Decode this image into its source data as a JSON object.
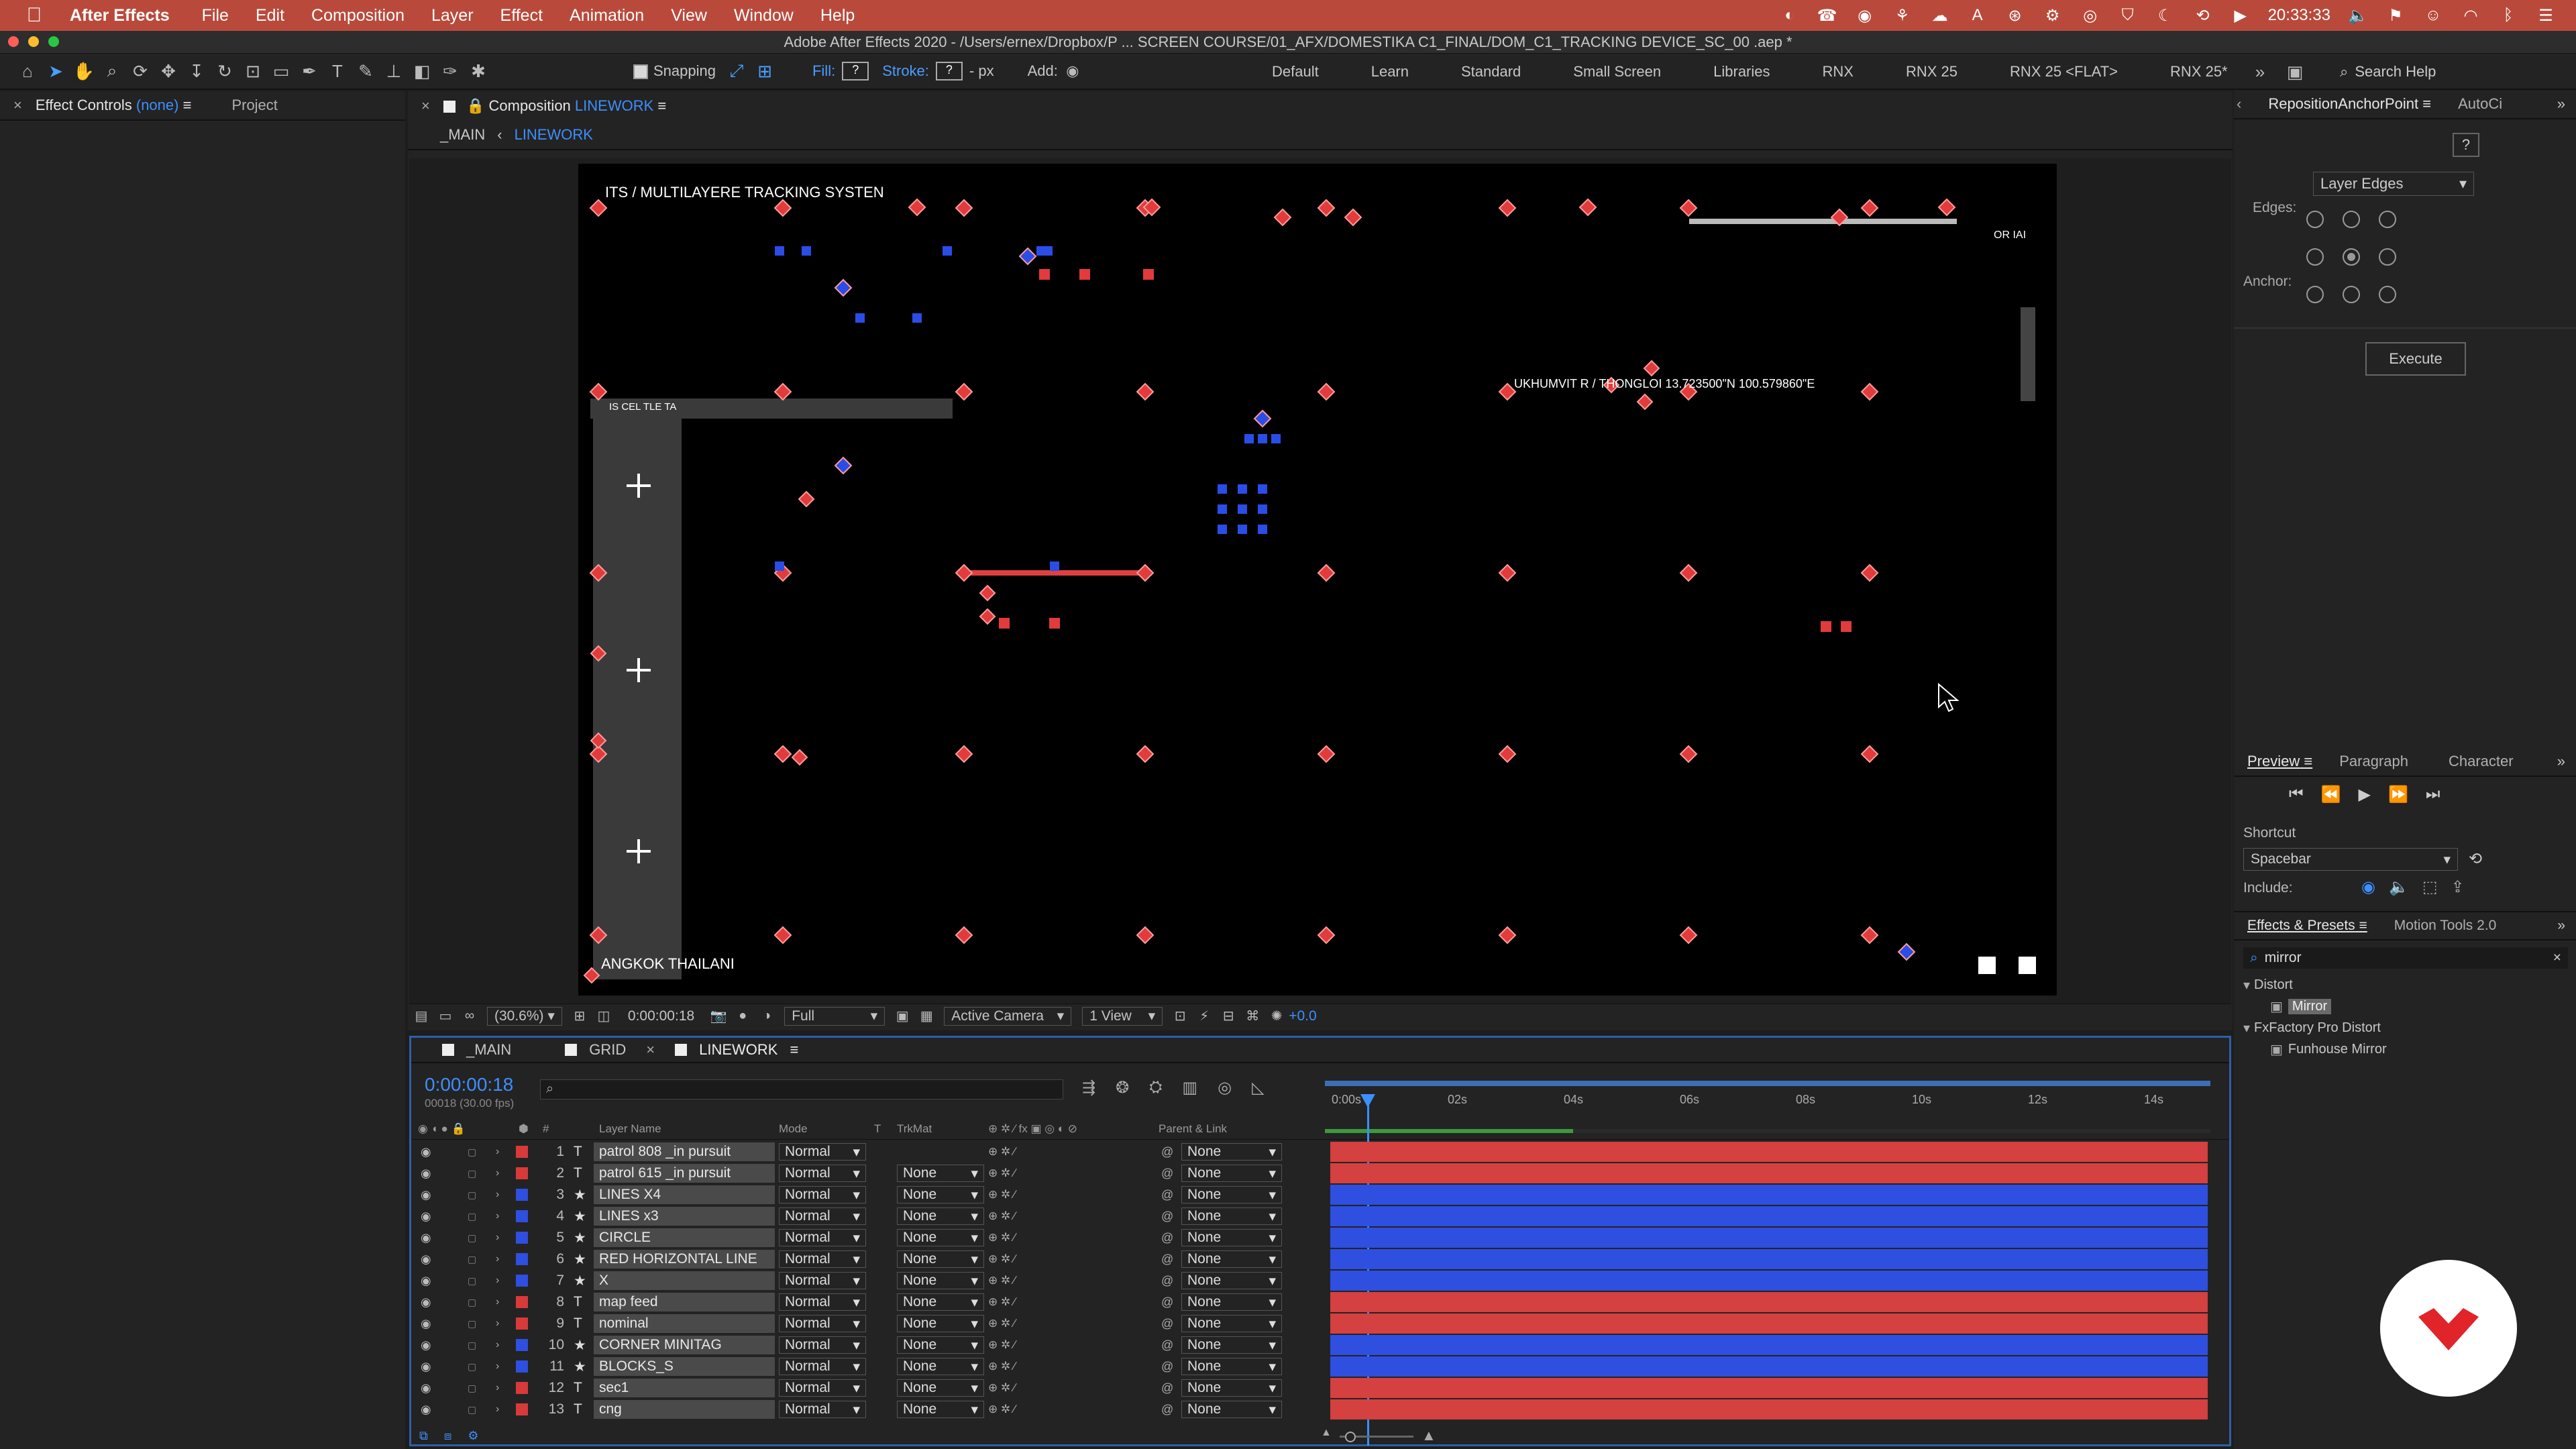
{
  "menubar": {
    "app": "After Effects",
    "items": [
      "File",
      "Edit",
      "Composition",
      "Layer",
      "Effect",
      "Animation",
      "View",
      "Window",
      "Help"
    ],
    "clock": "20:33:33"
  },
  "window": {
    "title": "Adobe After Effects 2020 - /Users/ernex/Dropbox/P ... SCREEN COURSE/01_AFX/DOMESTIKA C1_FINAL/DOM_C1_TRACKING DEVICE_SC_00 .aep *"
  },
  "toolbar": {
    "snapping_label": "Snapping",
    "fill_label": "Fill:",
    "fill_value": "?",
    "stroke_label": "Stroke:",
    "stroke_value": "?",
    "px_label": "- px",
    "add_label": "Add:",
    "workspaces": [
      "Default",
      "Learn",
      "Standard",
      "Small Screen",
      "Libraries",
      "RNX",
      "RNX 25",
      "RNX 25 <FLAT>",
      "RNX 25*"
    ],
    "search_placeholder": "Search Help"
  },
  "left_panel": {
    "tab_effect_controls": "Effect Controls",
    "effect_controls_value": "(none)",
    "tab_project": "Project"
  },
  "comp_panel": {
    "tab_label": "Composition",
    "tab_comp": "LINEWORK",
    "breadcrumb_main": "_MAIN",
    "breadcrumb_current": "LINEWORK",
    "texts": {
      "top_left": "ITS / MULTILAYERE  TRACKING SYSTEN",
      "top_right": "OR  IAI",
      "left_bar": "IS CEL   TLE TA",
      "coords": "UKHUMVIT R  / THONGLOI   13.723500\"N  100.579860\"E",
      "bottom_left": "ANGKOK  THAILANI"
    }
  },
  "viewer_footer": {
    "zoom": "(30.6%)",
    "timecode": "0:00:00:18",
    "resolution": "Full",
    "camera": "Active Camera",
    "views": "1 View",
    "exposure": "+0.0"
  },
  "timeline": {
    "tabs": [
      "_MAIN",
      "GRID",
      "LINEWORK"
    ],
    "current_time": "0:00:00:18",
    "frame_info": "00018 (30.00 fps)",
    "ruler": [
      "0:00s",
      "02s",
      "04s",
      "06s",
      "08s",
      "10s",
      "12s",
      "14s"
    ],
    "playhead_progress": 0.04,
    "headers": {
      "num": "#",
      "layer_name": "Layer Name",
      "mode": "Mode",
      "t": "T",
      "trkmat": "TrkMat",
      "parent": "Parent & Link"
    },
    "layers": [
      {
        "num": "1",
        "type": "T",
        "name": "patrol 808 _in pursuit",
        "mode": "Normal",
        "trkmat": "",
        "parent": "None",
        "label": "#d83a3a"
      },
      {
        "num": "2",
        "type": "T",
        "name": "patrol 615 _in pursuit",
        "mode": "Normal",
        "trkmat": "None",
        "parent": "None",
        "label": "#d83a3a"
      },
      {
        "num": "3",
        "type": "★",
        "name": "LINES X4",
        "mode": "Normal",
        "trkmat": "None",
        "parent": "None",
        "label": "#2e4fe0"
      },
      {
        "num": "4",
        "type": "★",
        "name": "LINES x3",
        "mode": "Normal",
        "trkmat": "None",
        "parent": "None",
        "label": "#2e4fe0"
      },
      {
        "num": "5",
        "type": "★",
        "name": "CIRCLE",
        "mode": "Normal",
        "trkmat": "None",
        "parent": "None",
        "label": "#2e4fe0"
      },
      {
        "num": "6",
        "type": "★",
        "name": "RED HORIZONTAL LINE",
        "mode": "Normal",
        "trkmat": "None",
        "parent": "None",
        "label": "#2e4fe0"
      },
      {
        "num": "7",
        "type": "★",
        "name": "X",
        "mode": "Normal",
        "trkmat": "None",
        "parent": "None",
        "label": "#2e4fe0"
      },
      {
        "num": "8",
        "type": "T",
        "name": "map feed",
        "mode": "Normal",
        "trkmat": "None",
        "parent": "None",
        "label": "#d83a3a"
      },
      {
        "num": "9",
        "type": "T",
        "name": "nominal",
        "mode": "Normal",
        "trkmat": "None",
        "parent": "None",
        "label": "#d83a3a"
      },
      {
        "num": "10",
        "type": "★",
        "name": "CORNER MINITAG",
        "mode": "Normal",
        "trkmat": "None",
        "parent": "None",
        "label": "#2e4fe0"
      },
      {
        "num": "11",
        "type": "★",
        "name": "BLOCKS_S",
        "mode": "Normal",
        "trkmat": "None",
        "parent": "None",
        "label": "#2e4fe0"
      },
      {
        "num": "12",
        "type": "T",
        "name": "sec1",
        "mode": "Normal",
        "trkmat": "None",
        "parent": "None",
        "label": "#d83a3a"
      },
      {
        "num": "13",
        "type": "T",
        "name": "cng",
        "mode": "Normal",
        "trkmat": "None",
        "parent": "None",
        "label": "#d83a3a"
      }
    ]
  },
  "script_panel": {
    "tab": "RepositionAnchorPoint",
    "tab2": "AutoCi",
    "help": "?",
    "edges_label": "Edges:",
    "edges_select": "Layer Edges",
    "anchor_label": "Anchor:",
    "execute": "Execute"
  },
  "preview_panel": {
    "tabs": [
      "Preview",
      "Paragraph",
      "Character"
    ],
    "shortcut_label": "Shortcut",
    "shortcut_value": "Spacebar",
    "include_label": "Include:"
  },
  "effects_panel": {
    "tab": "Effects & Presets",
    "tab2": "Motion Tools 2.0",
    "search_value": "mirror",
    "tree": [
      {
        "label": "Distort",
        "indent": 0
      },
      {
        "label": "Mirror",
        "indent": 1,
        "selected": true
      },
      {
        "label": "FxFactory Pro Distort",
        "indent": 0
      },
      {
        "label": "Funhouse Mirror",
        "indent": 1
      }
    ]
  },
  "colors": {
    "accent": "#3d8fff",
    "menubar": "#b94a3b",
    "red_layer": "#d54040",
    "blue_layer": "#2e4fe0"
  }
}
